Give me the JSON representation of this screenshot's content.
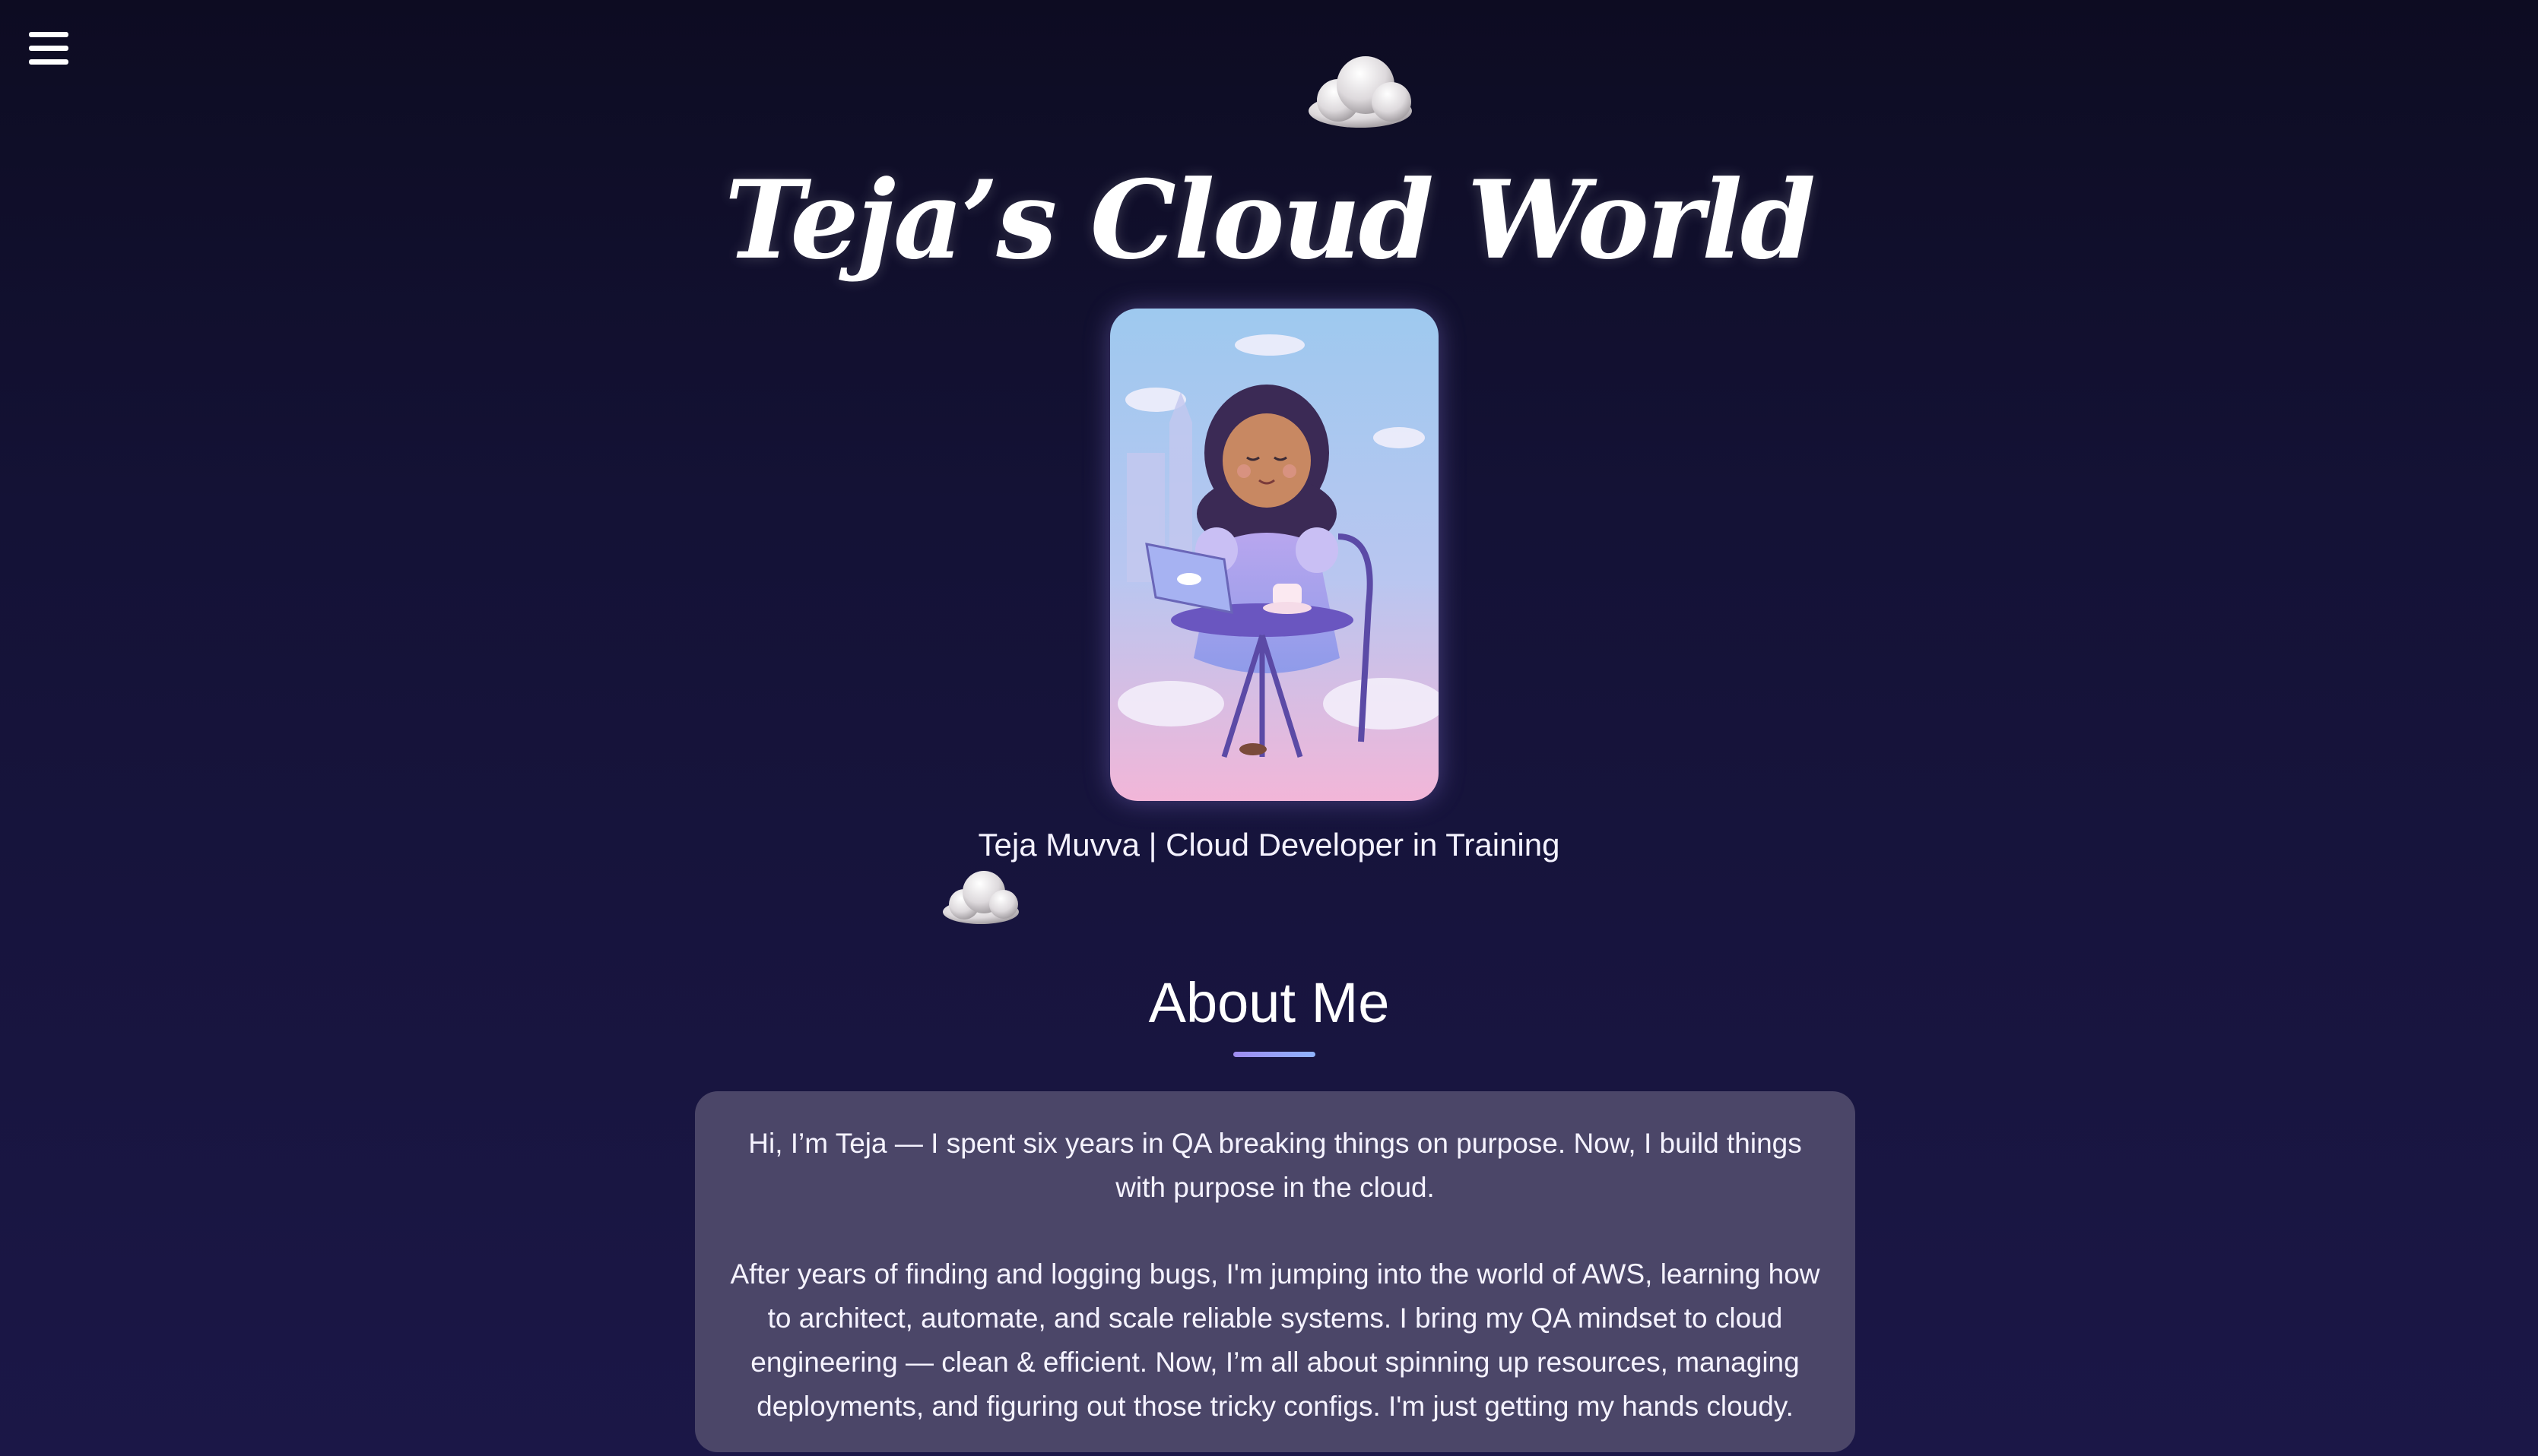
{
  "header": {
    "menu_icon": "hamburger-menu-icon",
    "title": "Teja’s Cloud World"
  },
  "decorations": {
    "top_cloud_icon": "cloud-icon",
    "mid_cloud_icon": "cloud-icon"
  },
  "profile": {
    "portrait_alt": "Illustrated portrait of a girl working on a laptop among clouds",
    "tagline": "Teja Muvva | Cloud Developer in Training"
  },
  "about": {
    "heading": "About Me",
    "paragraph_1": "Hi, I’m Teja — I spent six years in QA breaking things on purpose. Now, I build things with purpose in the cloud.",
    "paragraph_2": "After years of finding and logging bugs, I'm jumping into the world of AWS, learning how to architect, automate, and scale reliable systems. I bring my QA mindset to cloud engineering — clean & efficient. Now, I’m all about spinning up resources, managing deployments, and figuring out those tricky configs. I'm just getting my hands cloudy."
  },
  "colors": {
    "background_top": "#0d0c22",
    "background_bottom": "#1b1747",
    "card_background": "#4b4668",
    "underline_start": "#9f8cf0",
    "underline_end": "#8fb4ff"
  }
}
